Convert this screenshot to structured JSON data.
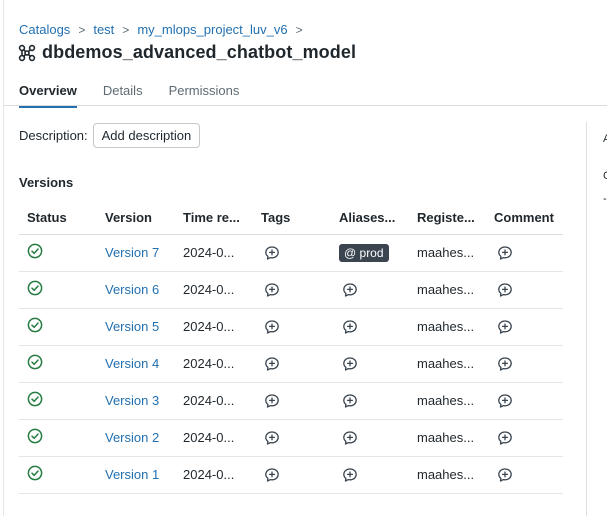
{
  "breadcrumb": [
    {
      "label": "Catalogs"
    },
    {
      "label": "test"
    },
    {
      "label": "my_mlops_project_luv_v6"
    }
  ],
  "breadcrumb_separator": ">",
  "model": {
    "title": "dbdemos_advanced_chatbot_model",
    "icon": "model-graph-icon"
  },
  "tabs": [
    {
      "label": "Overview",
      "active": true
    },
    {
      "label": "Details",
      "active": false
    },
    {
      "label": "Permissions",
      "active": false
    }
  ],
  "description": {
    "label": "Description:",
    "button_label": "Add description"
  },
  "versions": {
    "heading": "Versions",
    "columns": [
      "Status",
      "Version",
      "Time re...",
      "Tags",
      "Aliases...",
      "Registe...",
      "Comment"
    ],
    "rows": [
      {
        "status": "ready",
        "version": "Version 7",
        "time": "2024-0...",
        "alias": "@ prod",
        "registered_by": "maahes..."
      },
      {
        "status": "ready",
        "version": "Version 6",
        "time": "2024-0...",
        "alias": "",
        "registered_by": "maahes..."
      },
      {
        "status": "ready",
        "version": "Version 5",
        "time": "2024-0...",
        "alias": "",
        "registered_by": "maahes..."
      },
      {
        "status": "ready",
        "version": "Version 4",
        "time": "2024-0...",
        "alias": "",
        "registered_by": "maahes..."
      },
      {
        "status": "ready",
        "version": "Version 3",
        "time": "2024-0...",
        "alias": "",
        "registered_by": "maahes..."
      },
      {
        "status": "ready",
        "version": "Version 2",
        "time": "2024-0...",
        "alias": "",
        "registered_by": "maahes..."
      },
      {
        "status": "ready",
        "version": "Version 1",
        "time": "2024-0...",
        "alias": "",
        "registered_by": "maahes..."
      }
    ]
  },
  "right_panel_peek": [
    "A",
    "C",
    "-"
  ],
  "colors": {
    "accent": "#2270b1",
    "success": "#277c43",
    "badge": "#3a4550"
  }
}
